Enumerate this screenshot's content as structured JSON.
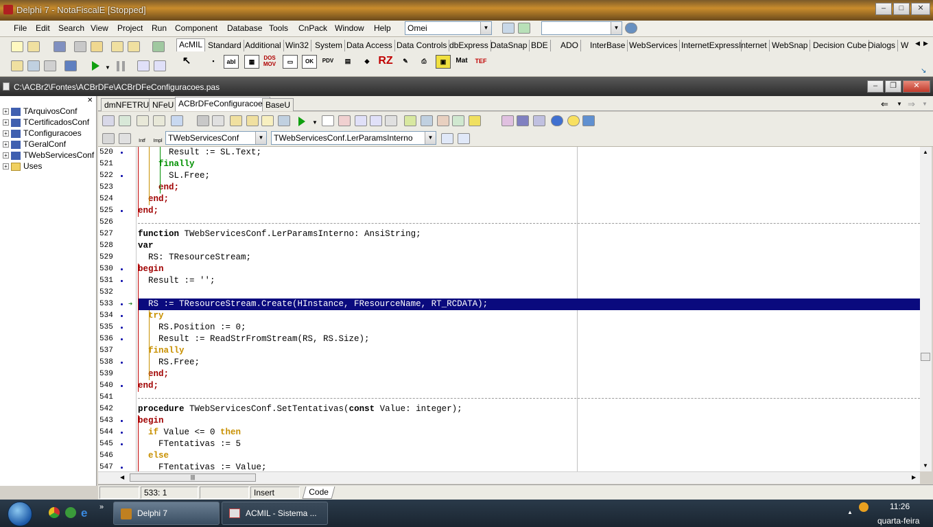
{
  "window": {
    "title": "Delphi 7 - NotaFiscalE [Stopped]"
  },
  "menu": [
    "File",
    "Edit",
    "Search",
    "View",
    "Project",
    "Run",
    "Component",
    "Database",
    "Tools",
    "CnPack",
    "Window",
    "Help"
  ],
  "desktop_combo": {
    "value": "Omei"
  },
  "search_combo": {
    "value": ""
  },
  "palette_tabs": [
    "AcMIL",
    "Standard",
    "Additional",
    "Win32",
    "System",
    "Data Access",
    "Data Controls",
    "dbExpress",
    "DataSnap",
    "BDE",
    "ADO",
    "InterBase",
    "WebServices",
    "InternetExpress",
    "Internet",
    "WebSnap",
    "Decision Cube",
    "Dialogs",
    "W"
  ],
  "palette_icons": [
    "abl",
    "DOS MOV",
    "OK",
    "PDV",
    "RZ",
    "Mat",
    "TEF"
  ],
  "editor": {
    "file_path": "C:\\ACBr2\\Fontes\\ACBrDFe\\ACBrDFeConfiguracoes.pas",
    "tabs": [
      "dmNFETRU",
      "NFeU",
      "ACBrDFeConfiguracoes",
      "BaseU"
    ],
    "class_combo": "TWebServicesConf",
    "method_combo": "TWebServicesConf.LerParamsInterno",
    "intf_label": "Intf",
    "impl_label": "Impl"
  },
  "tree": [
    "TArquivosConf",
    "TCertificadosConf",
    "TConfiguracoes",
    "TGeralConf",
    "TWebServicesConf",
    "Uses"
  ],
  "code_lines": [
    {
      "n": "520",
      "dot": true,
      "text": "      Result := SL.Text;"
    },
    {
      "n": "521",
      "dot": false,
      "text": "    finally"
    },
    {
      "n": "522",
      "dot": true,
      "text": "      SL.Free;"
    },
    {
      "n": "523",
      "dot": false,
      "text": "    end;"
    },
    {
      "n": "524",
      "dot": false,
      "text": "  end;"
    },
    {
      "n": "525",
      "dot": true,
      "text": "end;"
    },
    {
      "n": "526",
      "dot": false,
      "text": ""
    },
    {
      "n": "527",
      "dot": false,
      "text": "function TWebServicesConf.LerParamsInterno: AnsiString;"
    },
    {
      "n": "528",
      "dot": false,
      "text": "var"
    },
    {
      "n": "529",
      "dot": false,
      "text": "  RS: TResourceStream;"
    },
    {
      "n": "530",
      "dot": true,
      "text": "begin"
    },
    {
      "n": "531",
      "dot": true,
      "text": "  Result := '';"
    },
    {
      "n": "532",
      "dot": false,
      "text": ""
    },
    {
      "n": "533",
      "dot": true,
      "text": "  RS := TResourceStream.Create(HInstance, FResourceName, RT_RCDATA);"
    },
    {
      "n": "534",
      "dot": true,
      "text": "  try"
    },
    {
      "n": "535",
      "dot": true,
      "text": "    RS.Position := 0;"
    },
    {
      "n": "536",
      "dot": true,
      "text": "    Result := ReadStrFromStream(RS, RS.Size);"
    },
    {
      "n": "537",
      "dot": false,
      "text": "  finally"
    },
    {
      "n": "538",
      "dot": true,
      "text": "    RS.Free;"
    },
    {
      "n": "539",
      "dot": false,
      "text": "  end;"
    },
    {
      "n": "540",
      "dot": true,
      "text": "end;"
    },
    {
      "n": "541",
      "dot": false,
      "text": ""
    },
    {
      "n": "542",
      "dot": false,
      "text": "procedure TWebServicesConf.SetTentativas(const Value: integer);"
    },
    {
      "n": "543",
      "dot": true,
      "text": "begin"
    },
    {
      "n": "544",
      "dot": true,
      "text": "  if Value <= 0 then"
    },
    {
      "n": "545",
      "dot": true,
      "text": "    FTentativas := 5"
    },
    {
      "n": "546",
      "dot": false,
      "text": "  else"
    },
    {
      "n": "547",
      "dot": true,
      "text": "    FTentativas := Value;"
    }
  ],
  "gutter_bottom": "783",
  "status": {
    "position": "533:  1",
    "mode": "Insert",
    "tab": "Code"
  },
  "taskbar": {
    "buttons": [
      "Delphi 7",
      "ACMIL - Sistema ..."
    ],
    "time": "11:26",
    "day": "quarta-feira"
  },
  "colors": {
    "keyword_red": "#a00000",
    "keyword_gold": "#c89000",
    "keyword_green": "#009000",
    "highlight": "#0a0a7e"
  }
}
